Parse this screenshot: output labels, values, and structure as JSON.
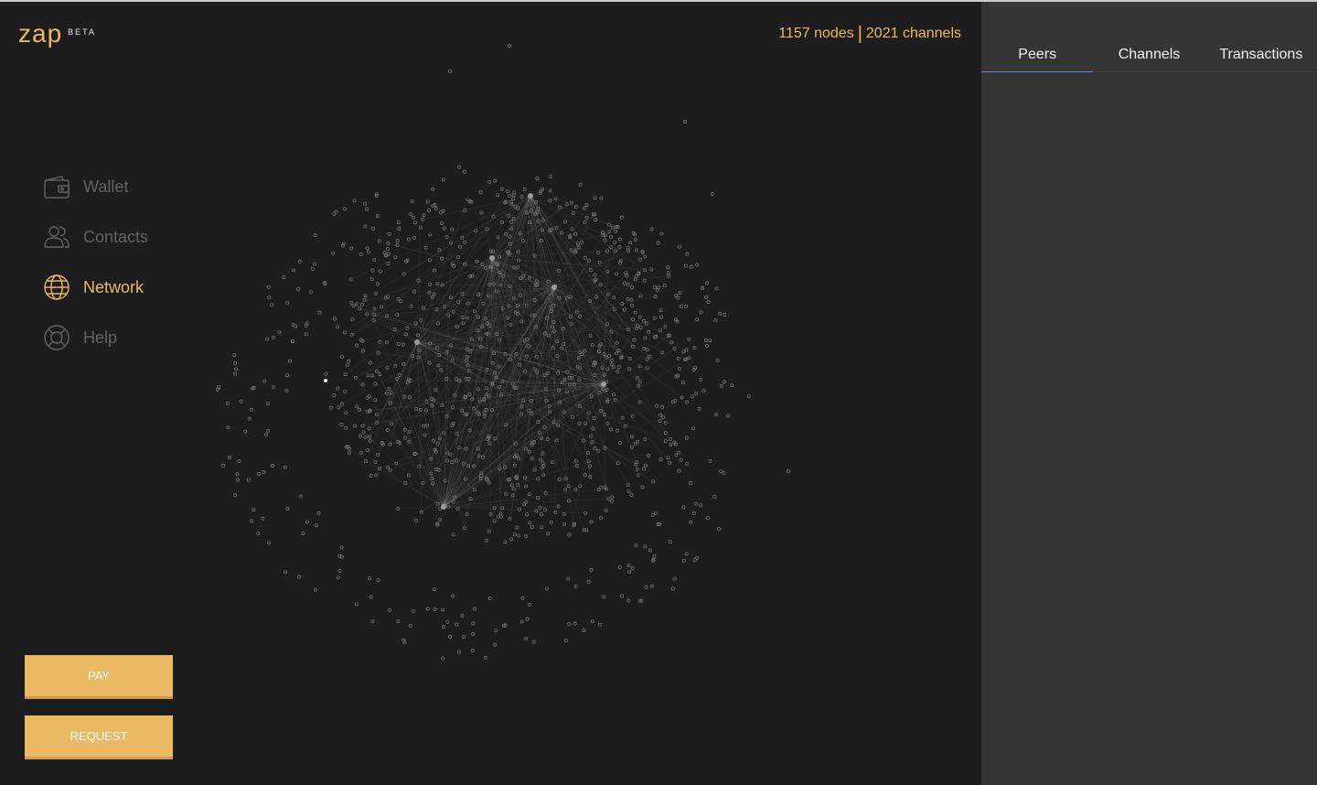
{
  "app": {
    "logo": "zap",
    "beta": "BETA"
  },
  "nav": {
    "items": [
      {
        "label": "Wallet",
        "icon": "wallet-icon",
        "active": false
      },
      {
        "label": "Contacts",
        "icon": "contacts-icon",
        "active": false
      },
      {
        "label": "Network",
        "icon": "globe-icon",
        "active": true
      },
      {
        "label": "Help",
        "icon": "lifebuoy-icon",
        "active": false
      }
    ]
  },
  "actions": {
    "pay_label": "PAY",
    "request_label": "REQUEST"
  },
  "network": {
    "nodes_label": "1157 nodes",
    "channels_label": "2021 channels",
    "separator": "|"
  },
  "tabs": [
    {
      "label": "Peers",
      "active": true
    },
    {
      "label": "Channels",
      "active": false
    },
    {
      "label": "Transactions",
      "active": false
    }
  ],
  "colors": {
    "accent": "#ebb864",
    "background": "#1d1d1d",
    "panel": "#353535",
    "tab_underline": "#5589e0",
    "node": "#7a7a7a"
  }
}
